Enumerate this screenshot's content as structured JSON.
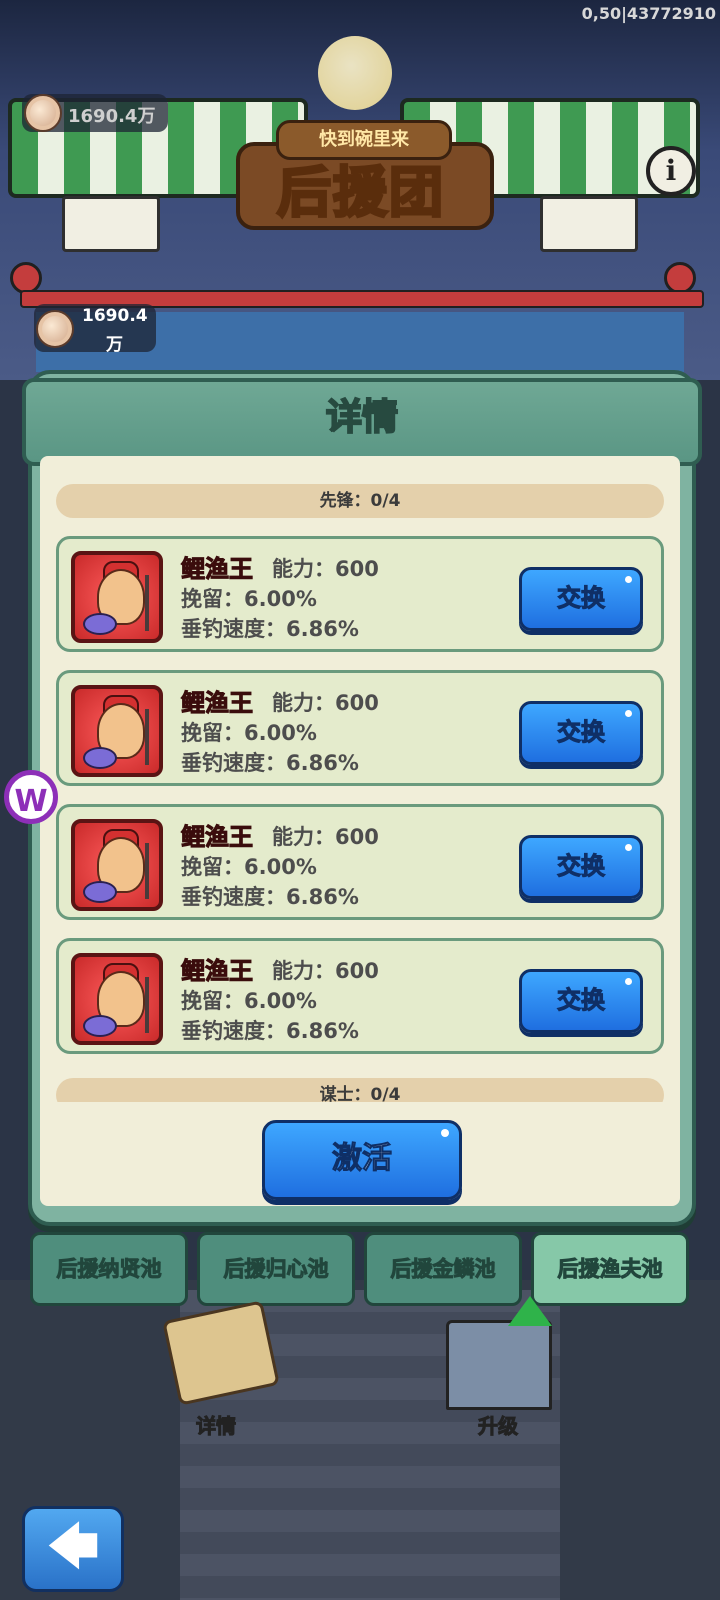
{
  "status_overlay": "0,50|43772910",
  "currency": {
    "amount_top": "1690.4万",
    "amount_panel_line1": "1690.4",
    "amount_panel_line2": "万"
  },
  "logo": {
    "subtitle": "快到碗里来",
    "title": "后援团"
  },
  "info_icon": "i",
  "modal": {
    "title": "详情",
    "section_top": "先锋：0/4",
    "section_bottom": "谋士：0/4",
    "cards": [
      {
        "name": "鲤渔王",
        "power": "能力：600",
        "retain": "挽留：6.00%",
        "speed": "垂钓速度：6.86%",
        "button": "交换"
      },
      {
        "name": "鲤渔王",
        "power": "能力：600",
        "retain": "挽留：6.00%",
        "speed": "垂钓速度：6.86%",
        "button": "交换"
      },
      {
        "name": "鲤渔王",
        "power": "能力：600",
        "retain": "挽留：6.00%",
        "speed": "垂钓速度：6.86%",
        "button": "交换"
      },
      {
        "name": "鲤渔王",
        "power": "能力：600",
        "retain": "挽留：6.00%",
        "speed": "垂钓速度：6.86%",
        "button": "交换"
      }
    ],
    "activate_button": "激活"
  },
  "tabs": [
    "后援纳贤池",
    "后援归心池",
    "后援金鳞池",
    "后援渔夫池"
  ],
  "active_tab": 3,
  "bottom": {
    "details_label": "详情",
    "upgrade_label": "升级"
  },
  "back_icon": "🡄",
  "watermark_letter": "W",
  "colors": {
    "accent_green": "#86c8a8",
    "button_blue": "#1f6fe0",
    "name_red": "#e8322e"
  }
}
